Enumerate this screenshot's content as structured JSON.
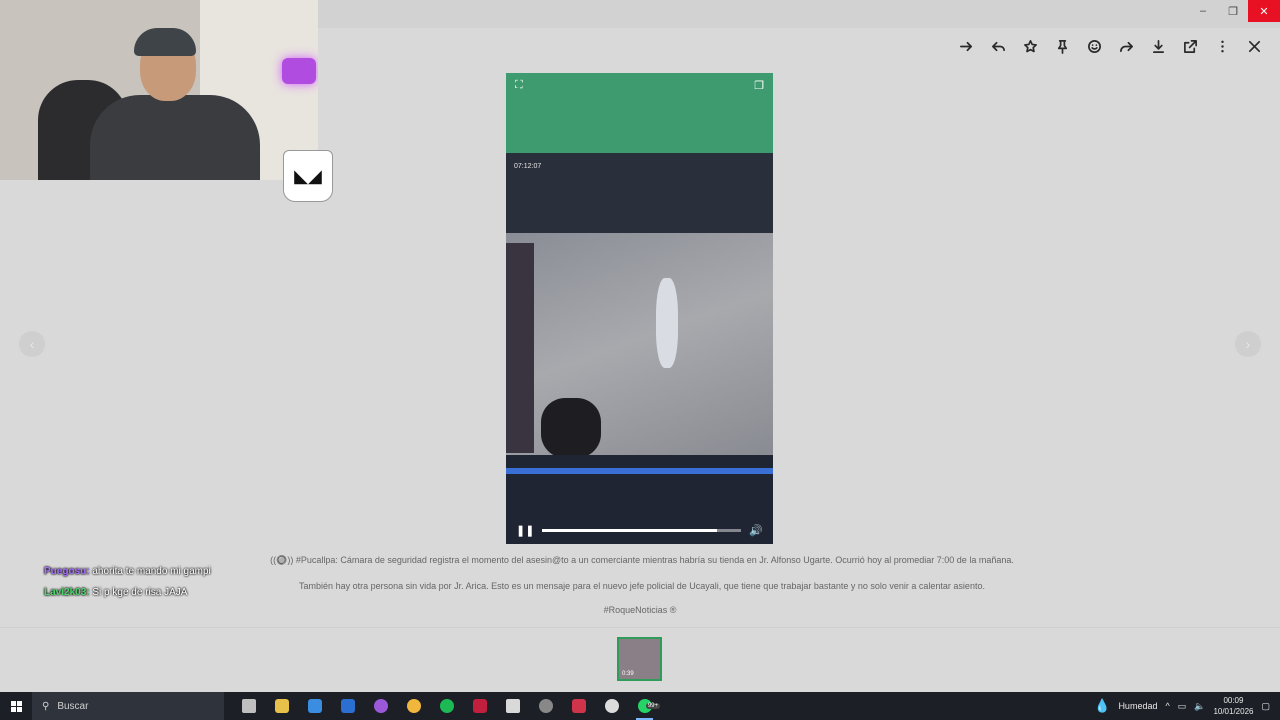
{
  "window": {
    "minimize": "–",
    "restore": "❐",
    "close": "✕"
  },
  "toolbar": {
    "icons": [
      "forward-icon",
      "reply-icon",
      "star-icon",
      "pin-icon",
      "emoji-icon",
      "share-icon",
      "download-icon",
      "open-external-icon",
      "more-icon",
      "close-icon"
    ]
  },
  "nav": {
    "prev": "‹",
    "next": "›"
  },
  "video": {
    "expand_icon": "⛶",
    "pip_icon": "❐",
    "progress_fraction": 0.88,
    "overlay_time": "07:12:07"
  },
  "caption": {
    "line1": "((🔘)) #Pucallpa: Cámara de seguridad registra el momento del asesin@to a un comerciante mientras habría su tienda en Jr. Alfonso Ugarte. Ocurrió hoy al promediar 7:00 de la mañana.",
    "line2": "También hay otra persona sin vida por Jr. Arica. Esto es un mensaje para el nuevo jefe policial de Ucayali, que tiene que trabajar bastante y no solo venir a calentar asiento.",
    "hashtag": "#RoqueNoticias ®"
  },
  "thumbnail": {
    "duration": "0:39"
  },
  "chat": [
    {
      "user": "Puegosu:",
      "message": "ahorita te mando mi gampi",
      "color": "#a970ff"
    },
    {
      "user": "Lavi2k03:",
      "message": "Si p kge de risa JAJA",
      "color": "#4fd66b"
    }
  ],
  "taskbar": {
    "search_placeholder": "Buscar",
    "apps": [
      {
        "name": "task-view",
        "color": "#bfbfbf"
      },
      {
        "name": "file-explorer",
        "color": "#e8c14a"
      },
      {
        "name": "store",
        "color": "#3a8de0"
      },
      {
        "name": "outlook",
        "color": "#2a6fd1"
      },
      {
        "name": "chrome-profile",
        "color": "#9b59d9"
      },
      {
        "name": "app-yellow",
        "color": "#f0b73c"
      },
      {
        "name": "spotify",
        "color": "#1db954"
      },
      {
        "name": "gx-browser",
        "color": "#c0203d"
      },
      {
        "name": "app-stack",
        "color": "#d9d9d9"
      },
      {
        "name": "chrome",
        "color": "#888888"
      },
      {
        "name": "app-red",
        "color": "#d0344b"
      },
      {
        "name": "obs",
        "color": "#dcdcdc"
      },
      {
        "name": "whatsapp",
        "color": "#25d366",
        "badge": "99+",
        "active": true
      }
    ],
    "weather": "Humedad",
    "time": "00:09",
    "date": "10/01/2026"
  }
}
